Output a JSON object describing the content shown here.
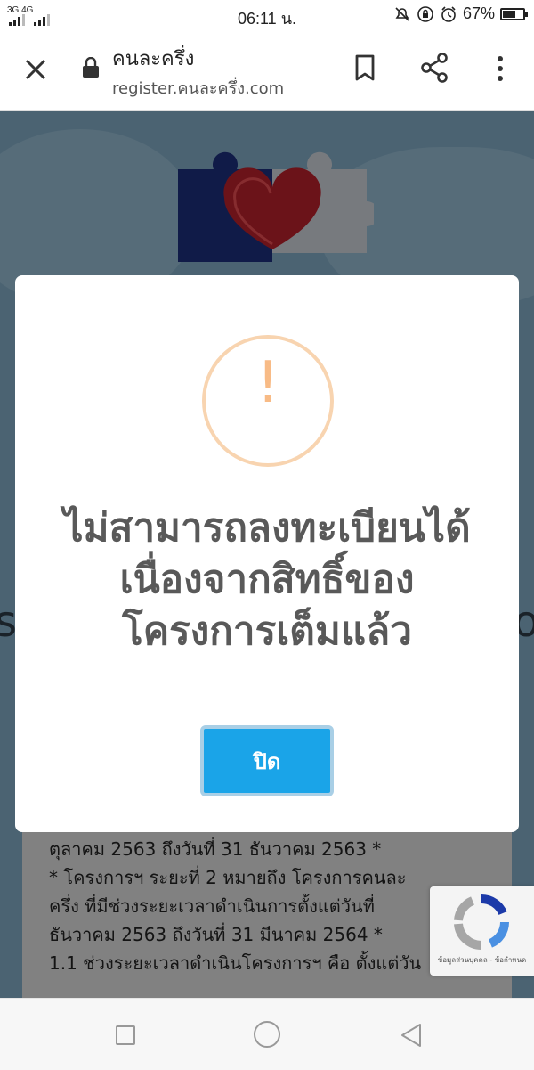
{
  "status_bar": {
    "network": "3G 4G",
    "time": "06:11 น.",
    "battery_percent": "67%",
    "battery_level": 0.67
  },
  "browser": {
    "page_title": "คนละครึ่ง",
    "url": "register.คนละครึ่ง.com",
    "icons": [
      "close-icon",
      "lock-icon",
      "bookmark-icon",
      "share-icon",
      "more-vert-icon"
    ]
  },
  "page": {
    "content_lines": [
      "ตุลาคม 2563 ถึงวันที่ 31 ธันวาคม 2563 *",
      "* โครงการฯ ระยะที่ 2 หมายถึง โครงการคนละ",
      "ครึ่ง ที่มีช่วงระยะเวลาดำเนินการตั้งแต่วันที่",
      "ธันวาคม 2563 ถึงวันที่ 31 มีนาคม 2564 *",
      "1.1 ช่วงระยะเวลาดำเนินโครงการฯ คือ ตั้งแต่วัน"
    ],
    "edge_left": "s",
    "edge_right": "o"
  },
  "modal": {
    "icon": "warning-icon",
    "icon_glyph": "!",
    "message_lines": [
      "ไม่สามารถลงทะเบียนได้",
      "เนื่องจากสิทธิ์ของ",
      "โครงการเต็มแล้ว"
    ],
    "button_label": "ปิด",
    "accent_color": "#1aa4e8",
    "warning_color": "#f8bb86"
  },
  "recaptcha": {
    "text": "ข้อมูลส่วนบุคคล - ข้อกำหนด"
  }
}
